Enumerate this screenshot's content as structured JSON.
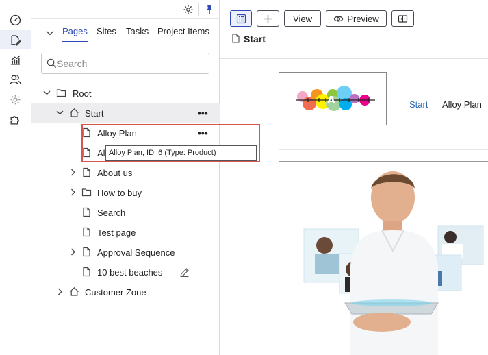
{
  "tree": {
    "tabs": [
      "Pages",
      "Sites",
      "Tasks",
      "Project Items"
    ],
    "search_placeholder": "Search",
    "nodes": [
      {
        "label": "Root"
      },
      {
        "label": "Start"
      },
      {
        "label": "Alloy Plan"
      },
      {
        "label": "Alloy Me"
      },
      {
        "label": "About us"
      },
      {
        "label": "How to buy"
      },
      {
        "label": "Search"
      },
      {
        "label": "Test page"
      },
      {
        "label": "Approval Sequence"
      },
      {
        "label": "10 best beaches"
      },
      {
        "label": "Customer Zone"
      }
    ],
    "more_glyph": "•••",
    "tooltip": "Alloy Plan, ID: 6 (Type: Product)"
  },
  "toolbar": {
    "view_label": "View",
    "preview_label": "Preview",
    "page_name": "Start"
  },
  "preview": {
    "logo_letter": "A",
    "nav": [
      "Start",
      "Alloy Plan"
    ]
  },
  "colors": {
    "accent": "#2d4ab5",
    "highlight": "#d9534f",
    "selected_bg": "#ededf0"
  }
}
